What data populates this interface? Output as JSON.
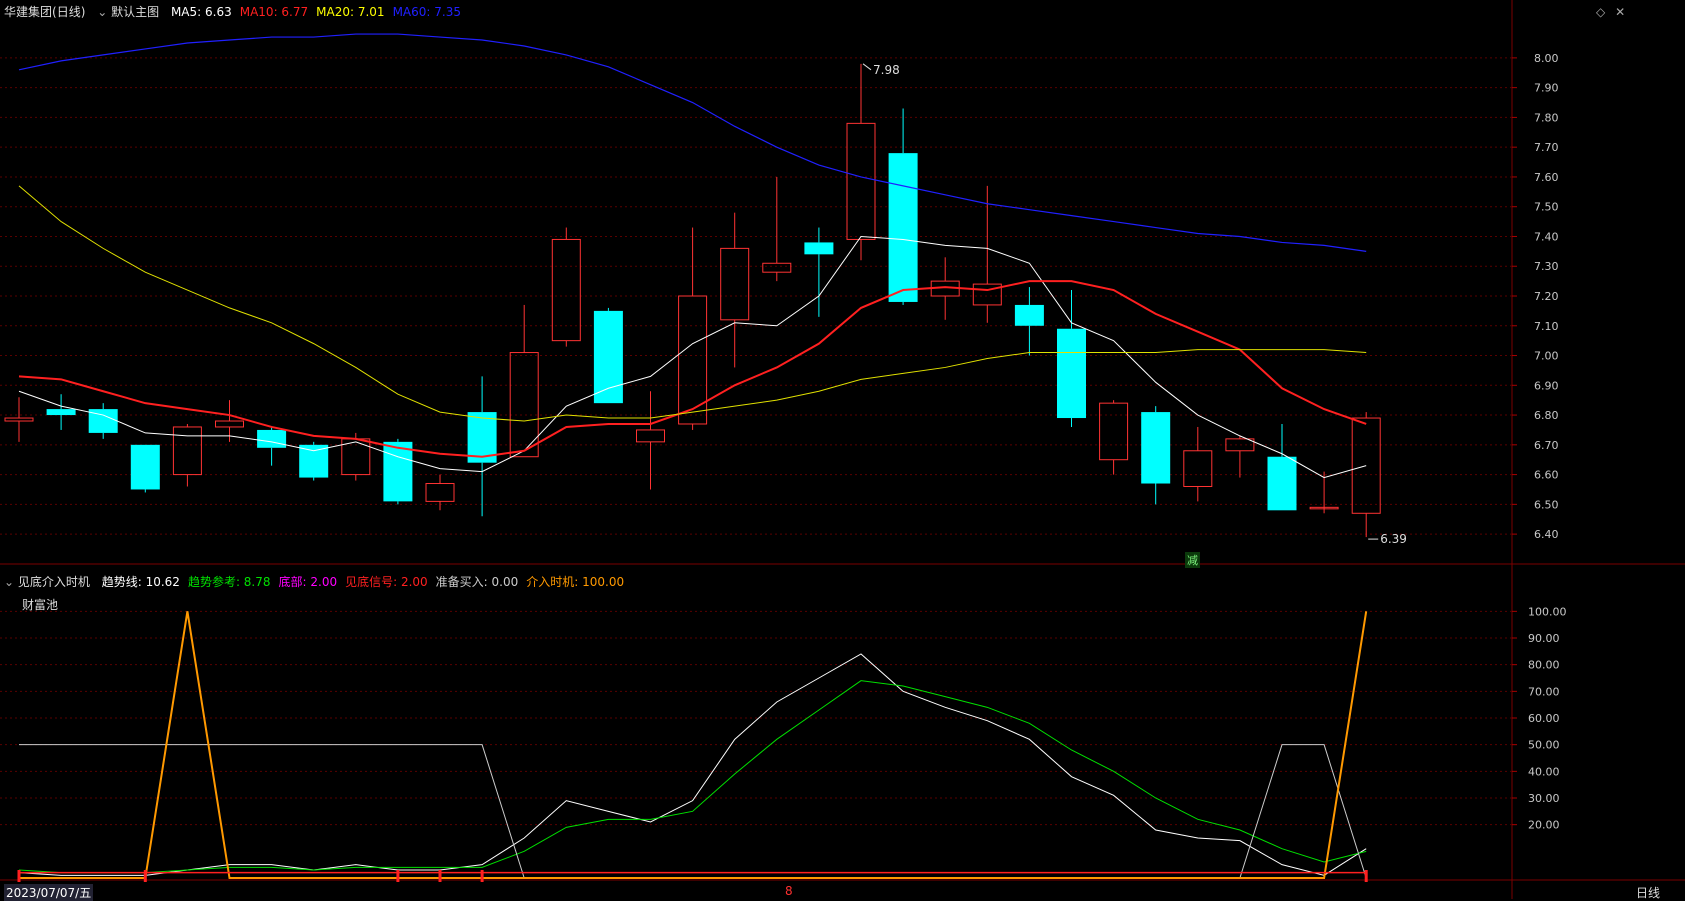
{
  "main": {
    "stock_name": "华建集团",
    "period": "日线",
    "template": "默认主图",
    "ma": [
      {
        "label": "MA5",
        "value": "6.63",
        "color": "#ffffff"
      },
      {
        "label": "MA10",
        "value": "6.77",
        "color": "#ff2020"
      },
      {
        "label": "MA20",
        "value": "7.01",
        "color": "#ffff00"
      },
      {
        "label": "MA60",
        "value": "7.35",
        "color": "#2020ff"
      }
    ],
    "high_label": "7.98",
    "low_label": "6.39",
    "badge": "减"
  },
  "indicator": {
    "name": "见底介入时机",
    "pool_label": "财富池",
    "params": [
      {
        "label": "趋势线",
        "value": "10.62",
        "color": "#ffffff"
      },
      {
        "label": "趋势参考",
        "value": "8.78",
        "color": "#00e000"
      },
      {
        "label": "底部",
        "value": "2.00",
        "color": "#ff00ff"
      },
      {
        "label": "见底信号",
        "value": "2.00",
        "color": "#ff2020"
      },
      {
        "label": "准备买入",
        "value": "0.00",
        "color": "#cccccc"
      },
      {
        "label": "介入时机",
        "value": "100.00",
        "color": "#ff9900"
      }
    ]
  },
  "footer": {
    "date": "2023/07/07/五",
    "month_marker": "8",
    "period_tab": "日线"
  },
  "chart_data": [
    {
      "type": "candlestick",
      "y_ticks": [
        "8.00",
        "7.90",
        "7.80",
        "7.70",
        "7.60",
        "7.50",
        "7.40",
        "7.30",
        "7.20",
        "7.10",
        "7.00",
        "6.90",
        "6.80",
        "6.70",
        "6.60",
        "6.50",
        "6.40"
      ],
      "ylim": [
        6.35,
        8.05
      ],
      "candles": [
        {
          "o": 6.78,
          "h": 6.86,
          "l": 6.71,
          "c": 6.79
        },
        {
          "o": 6.82,
          "h": 6.87,
          "l": 6.75,
          "c": 6.8
        },
        {
          "o": 6.82,
          "h": 6.84,
          "l": 6.72,
          "c": 6.74
        },
        {
          "o": 6.7,
          "h": 6.7,
          "l": 6.54,
          "c": 6.55
        },
        {
          "o": 6.6,
          "h": 6.77,
          "l": 6.56,
          "c": 6.76
        },
        {
          "o": 6.76,
          "h": 6.85,
          "l": 6.71,
          "c": 6.78
        },
        {
          "o": 6.75,
          "h": 6.76,
          "l": 6.63,
          "c": 6.69
        },
        {
          "o": 6.7,
          "h": 6.71,
          "l": 6.58,
          "c": 6.59
        },
        {
          "o": 6.6,
          "h": 6.74,
          "l": 6.58,
          "c": 6.72
        },
        {
          "o": 6.71,
          "h": 6.72,
          "l": 6.5,
          "c": 6.51
        },
        {
          "o": 6.51,
          "h": 6.6,
          "l": 6.48,
          "c": 6.57
        },
        {
          "o": 6.81,
          "h": 6.93,
          "l": 6.46,
          "c": 6.64
        },
        {
          "o": 6.66,
          "h": 7.17,
          "l": 6.66,
          "c": 7.01
        },
        {
          "o": 7.05,
          "h": 7.43,
          "l": 7.03,
          "c": 7.39
        },
        {
          "o": 7.15,
          "h": 7.16,
          "l": 6.84,
          "c": 6.84
        },
        {
          "o": 6.71,
          "h": 6.88,
          "l": 6.55,
          "c": 6.75
        },
        {
          "o": 6.77,
          "h": 7.43,
          "l": 6.75,
          "c": 7.2
        },
        {
          "o": 7.12,
          "h": 7.48,
          "l": 6.96,
          "c": 7.36
        },
        {
          "o": 7.28,
          "h": 7.6,
          "l": 7.25,
          "c": 7.31
        },
        {
          "o": 7.38,
          "h": 7.43,
          "l": 7.13,
          "c": 7.34
        },
        {
          "o": 7.39,
          "h": 7.98,
          "l": 7.32,
          "c": 7.78
        },
        {
          "o": 7.68,
          "h": 7.83,
          "l": 7.17,
          "c": 7.18
        },
        {
          "o": 7.2,
          "h": 7.33,
          "l": 7.12,
          "c": 7.25
        },
        {
          "o": 7.17,
          "h": 7.57,
          "l": 7.11,
          "c": 7.24
        },
        {
          "o": 7.17,
          "h": 7.23,
          "l": 7.0,
          "c": 7.1
        },
        {
          "o": 7.09,
          "h": 7.22,
          "l": 6.76,
          "c": 6.79
        },
        {
          "o": 6.65,
          "h": 6.85,
          "l": 6.6,
          "c": 6.84
        },
        {
          "o": 6.81,
          "h": 6.83,
          "l": 6.5,
          "c": 6.57
        },
        {
          "o": 6.56,
          "h": 6.76,
          "l": 6.51,
          "c": 6.68
        },
        {
          "o": 6.68,
          "h": 6.73,
          "l": 6.59,
          "c": 6.72
        },
        {
          "o": 6.66,
          "h": 6.77,
          "l": 6.48,
          "c": 6.48
        },
        {
          "o": 6.49,
          "h": 6.61,
          "l": 6.47,
          "c": 6.49
        },
        {
          "o": 6.47,
          "h": 6.81,
          "l": 6.39,
          "c": 6.79
        }
      ],
      "ma_series": {
        "MA5": [
          6.88,
          6.83,
          6.8,
          6.74,
          6.73,
          6.73,
          6.71,
          6.68,
          6.71,
          6.66,
          6.62,
          6.61,
          6.68,
          6.83,
          6.89,
          6.93,
          7.04,
          7.11,
          7.1,
          7.2,
          7.4,
          7.39,
          7.37,
          7.36,
          7.31,
          7.11,
          7.05,
          6.91,
          6.8,
          6.73,
          6.67,
          6.59,
          6.63
        ],
        "MA10": [
          6.93,
          6.92,
          6.88,
          6.84,
          6.82,
          6.8,
          6.76,
          6.73,
          6.72,
          6.69,
          6.67,
          6.66,
          6.68,
          6.76,
          6.77,
          6.77,
          6.82,
          6.9,
          6.96,
          7.04,
          7.16,
          7.22,
          7.23,
          7.22,
          7.25,
          7.25,
          7.22,
          7.14,
          7.08,
          7.02,
          6.89,
          6.82,
          6.77
        ],
        "MA20": [
          7.57,
          7.45,
          7.36,
          7.28,
          7.22,
          7.16,
          7.11,
          7.04,
          6.96,
          6.87,
          6.81,
          6.79,
          6.78,
          6.8,
          6.79,
          6.79,
          6.81,
          6.83,
          6.85,
          6.88,
          6.92,
          6.94,
          6.96,
          6.99,
          7.01,
          7.01,
          7.01,
          7.01,
          7.02,
          7.02,
          7.02,
          7.02,
          7.01
        ],
        "MA60": [
          7.96,
          7.99,
          8.01,
          8.03,
          8.05,
          8.06,
          8.07,
          8.07,
          8.08,
          8.08,
          8.07,
          8.06,
          8.04,
          8.01,
          7.97,
          7.91,
          7.85,
          7.77,
          7.7,
          7.64,
          7.6,
          7.57,
          7.54,
          7.51,
          7.49,
          7.47,
          7.45,
          7.43,
          7.41,
          7.4,
          7.38,
          7.37,
          7.35
        ]
      }
    },
    {
      "type": "line",
      "y_ticks": [
        "100.00",
        "90.00",
        "80.00",
        "70.00",
        "60.00",
        "50.00",
        "40.00",
        "30.00",
        "20.00"
      ],
      "ylim": [
        0,
        105
      ],
      "series": [
        {
          "label": "趋势线",
          "color": "#ffffff",
          "values": [
            2,
            1,
            1,
            1,
            3,
            5,
            5,
            3,
            5,
            3,
            3,
            5,
            15,
            29,
            25,
            21,
            29,
            52,
            66,
            75,
            84,
            70,
            64,
            59,
            52,
            38,
            31,
            18,
            15,
            14,
            5,
            1,
            11
          ]
        },
        {
          "label": "趋势参考",
          "color": "#00e000",
          "values": [
            3,
            2,
            2,
            2,
            3,
            4,
            4,
            3,
            4,
            4,
            4,
            4,
            10,
            19,
            22,
            22,
            25,
            39,
            52,
            63,
            74,
            72,
            68,
            64,
            58,
            48,
            40,
            30,
            22,
            18,
            11,
            6,
            10
          ]
        },
        {
          "label": "准备买入",
          "color": "#cccccc",
          "values": [
            50,
            50,
            50,
            50,
            50,
            50,
            50,
            50,
            50,
            50,
            50,
            50,
            0,
            0,
            0,
            0,
            0,
            0,
            0,
            0,
            0,
            0,
            0,
            0,
            0,
            0,
            0,
            0,
            0,
            0,
            50,
            50,
            0
          ]
        },
        {
          "label": "介入时机",
          "color": "#ff9900",
          "values": [
            0,
            0,
            0,
            0,
            100,
            0,
            0,
            0,
            0,
            0,
            0,
            0,
            0,
            0,
            0,
            0,
            0,
            0,
            0,
            0,
            0,
            0,
            0,
            0,
            0,
            0,
            0,
            0,
            0,
            0,
            0,
            0,
            100
          ]
        },
        {
          "label": "见底信号",
          "color": "#ff2020",
          "values": [
            2,
            2,
            2,
            2,
            2,
            2,
            2,
            2,
            2,
            2,
            2,
            2,
            2,
            2,
            2,
            2,
            2,
            2,
            2,
            2,
            2,
            2,
            2,
            2,
            2,
            2,
            2,
            2,
            2,
            2,
            2,
            2,
            2
          ]
        }
      ],
      "signal_markers": [
        0,
        3,
        9,
        10,
        11,
        32
      ]
    }
  ]
}
